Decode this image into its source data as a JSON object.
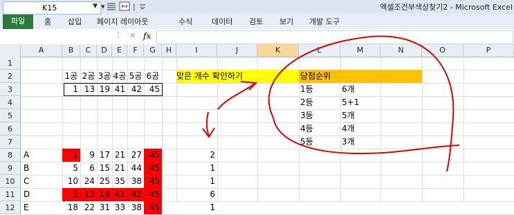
{
  "window": {
    "title": "엑셀조건부색상찾기2 - Microsoft Excel"
  },
  "ribbon": {
    "file_tab": "파일",
    "tabs": [
      "홈",
      "삽입",
      "페이지 레이아웃",
      "수식",
      "데이터",
      "검토",
      "보기",
      "개발 도구"
    ]
  },
  "formula_bar": {
    "name_box": "K15",
    "fx": "fx",
    "value": ""
  },
  "columns": [
    "A",
    "B",
    "C",
    "D",
    "E",
    "F",
    "G",
    "H",
    "I",
    "J",
    "K",
    "L",
    "M",
    "N",
    "O",
    "P"
  ],
  "selected_column": "K",
  "rows": [
    "1",
    "2",
    "3",
    "4",
    "5",
    "6",
    "7",
    "8",
    "9",
    "10",
    "11",
    "12"
  ],
  "header_row": [
    "1공",
    "2공",
    "3공",
    "4공",
    "5공",
    "6공"
  ],
  "winning_numbers": [
    "1",
    "13",
    "19",
    "41",
    "42",
    "45"
  ],
  "check_label": "맞은 개수 확인하기",
  "prize_table": {
    "header": "당첨순위",
    "rows": [
      {
        "rank": "1등",
        "match": "6개"
      },
      {
        "rank": "2등",
        "match": "5+1"
      },
      {
        "rank": "3등",
        "match": "5개"
      },
      {
        "rank": "4등",
        "match": "4개"
      },
      {
        "rank": "5등",
        "match": "3개"
      }
    ]
  },
  "tickets": [
    {
      "label": "A",
      "nums": [
        "1",
        "9",
        "17",
        "21",
        "27",
        "45"
      ],
      "match": "2",
      "highlight": [
        true,
        false,
        false,
        false,
        false,
        true
      ]
    },
    {
      "label": "B",
      "nums": [
        "5",
        "6",
        "15",
        "21",
        "44",
        "45"
      ],
      "match": "1",
      "highlight": [
        false,
        false,
        false,
        false,
        false,
        true
      ]
    },
    {
      "label": "C",
      "nums": [
        "10",
        "24",
        "25",
        "35",
        "38",
        "45"
      ],
      "match": "1",
      "highlight": [
        false,
        false,
        false,
        false,
        false,
        true
      ]
    },
    {
      "label": "D",
      "nums": [
        "1",
        "13",
        "19",
        "41",
        "42",
        "45"
      ],
      "match": "6",
      "highlight": [
        true,
        true,
        true,
        true,
        true,
        true
      ]
    },
    {
      "label": "E",
      "nums": [
        "18",
        "22",
        "31",
        "33",
        "38",
        "45"
      ],
      "match": "1",
      "highlight": [
        false,
        false,
        false,
        false,
        false,
        true
      ]
    }
  ],
  "colors": {
    "highlight": "#ff0000",
    "yellow": "#ffff00",
    "orange": "#ffc000",
    "annotation": "#e00000",
    "file_tab": "#2a7a3c"
  }
}
